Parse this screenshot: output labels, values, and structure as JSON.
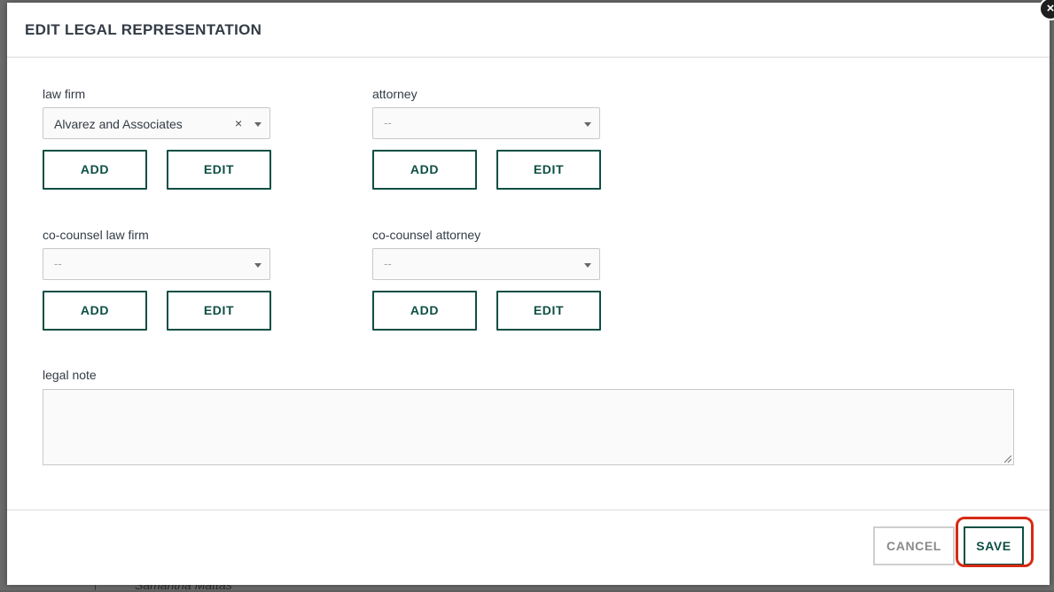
{
  "background": {
    "partial_text": "Samantha Mattas"
  },
  "modal": {
    "title": "EDIT LEGAL REPRESENTATION",
    "close_glyph": "×"
  },
  "fields": {
    "law_firm": {
      "label": "law firm",
      "value": "Alvarez and Associates",
      "clear_glyph": "×",
      "add_label": "ADD",
      "edit_label": "EDIT"
    },
    "attorney": {
      "label": "attorney",
      "placeholder": "--",
      "add_label": "ADD",
      "edit_label": "EDIT"
    },
    "co_counsel_law_firm": {
      "label": "co-counsel law firm",
      "placeholder": "--",
      "add_label": "ADD",
      "edit_label": "EDIT"
    },
    "co_counsel_attorney": {
      "label": "co-counsel attorney",
      "placeholder": "--",
      "add_label": "ADD",
      "edit_label": "EDIT"
    },
    "legal_note": {
      "label": "legal note",
      "value": ""
    }
  },
  "footer": {
    "cancel_label": "CANCEL",
    "save_label": "SAVE"
  },
  "colors": {
    "accent": "#0d4f43",
    "highlight": "#d62a12",
    "text": "#333b45"
  }
}
